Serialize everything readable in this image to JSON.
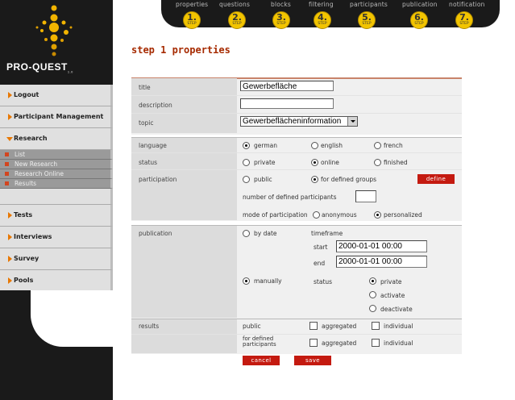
{
  "logo": {
    "text": "PRO-QUEST",
    "sup": "1.0"
  },
  "steps": [
    {
      "label": "properties",
      "num": "1.",
      "step": "STEP"
    },
    {
      "label": "questions",
      "num": "2.",
      "step": "STEP"
    },
    {
      "label": "blocks",
      "num": "3.",
      "step": "STEP"
    },
    {
      "label": "filtering",
      "num": "4.",
      "step": "STEP"
    },
    {
      "label": "participants",
      "num": "5.",
      "step": "STEP"
    },
    {
      "label": "publication",
      "num": "6.",
      "step": "STEP"
    },
    {
      "label": "notification",
      "num": "7.",
      "step": "STEP"
    }
  ],
  "sidebar": {
    "logout": "Logout",
    "participant_management": "Participant Management",
    "research": "Research",
    "research_sub": [
      "List",
      "New Research",
      "Research Online",
      "Results"
    ],
    "tests": "Tests",
    "interviews": "Interviews",
    "survey": "Survey",
    "pools": "Pools"
  },
  "page_title": "step 1 properties",
  "form": {
    "title_label": "title",
    "title_value": "Gewerbefläche",
    "description_label": "description",
    "description_value": "",
    "topic_label": "topic",
    "topic_value": "Gewerbeflächeninformation",
    "language_label": "language",
    "language_options": [
      "german",
      "english",
      "french"
    ],
    "status_label": "status",
    "status_options": [
      "private",
      "online",
      "finished"
    ],
    "participation_label": "participation",
    "participation_options": [
      "public",
      "for defined groups"
    ],
    "define_button": "define",
    "num_defined_label": "number of defined participants",
    "num_defined_value": "",
    "mode_label": "mode of participation",
    "mode_options": [
      "anonymous",
      "personalized"
    ],
    "publication_label": "publication",
    "by_date": "by date",
    "timeframe": "timeframe",
    "start_label": "start",
    "start_value": "2000-01-01 00:00",
    "end_label": "end",
    "end_value": "2000-01-01 00:00",
    "manually": "manually",
    "pub_status_label": "status",
    "pub_status_options": [
      "private",
      "activate",
      "deactivate"
    ],
    "results_label": "results",
    "public_label": "public",
    "defined_participants_label": "for defined participants",
    "aggregated": "aggregated",
    "individual": "individual",
    "cancel_button": "cancel",
    "save_button": "save"
  },
  "colors": {
    "accent": "#c41a10",
    "title": "#a62a00",
    "step": "#f2c400",
    "nav_arrow": "#e87700"
  }
}
